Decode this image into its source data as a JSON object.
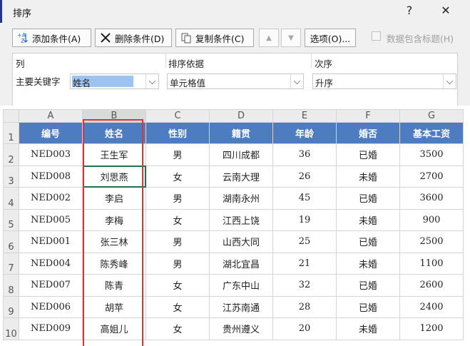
{
  "dialog": {
    "title": "排序",
    "help_label": "?",
    "close_label": "✕",
    "toolbar": {
      "add_label": "添加条件(A)",
      "delete_label": "删除条件(D)",
      "copy_label": "复制条件(C)",
      "up_label": "▲",
      "down_label": "▼",
      "options_label": "选项(O)...",
      "header_checkbox_label": "数据包含标题(H)"
    },
    "columns": {
      "col_header": "列",
      "basis_header": "排序依据",
      "order_header": "次序"
    },
    "criterion": {
      "row_label": "主要关键字",
      "column_value": "姓名",
      "basis_value": "单元格值",
      "order_value": "升序",
      "dropdown_glyph": "⌵"
    }
  },
  "sheet": {
    "col_letters": [
      "A",
      "B",
      "C",
      "D",
      "E",
      "F",
      "G"
    ],
    "headers": [
      "编号",
      "姓名",
      "性别",
      "籍贯",
      "年龄",
      "婚否",
      "基本工资"
    ],
    "rows": [
      [
        "NED003",
        "王生军",
        "男",
        "四川成都",
        "36",
        "已婚",
        "3500"
      ],
      [
        "NED008",
        "刘思燕",
        "女",
        "云南大理",
        "26",
        "未婚",
        "2700"
      ],
      [
        "NED002",
        "李启",
        "男",
        "湖南永州",
        "45",
        "已婚",
        "3600"
      ],
      [
        "NED005",
        "李梅",
        "女",
        "江西上饶",
        "19",
        "未婚",
        "900"
      ],
      [
        "NED001",
        "张三林",
        "男",
        "山西大同",
        "25",
        "已婚",
        "2500"
      ],
      [
        "NED004",
        "陈秀峰",
        "男",
        "湖北宜昌",
        "21",
        "未婚",
        "1100"
      ],
      [
        "NED007",
        "陈青",
        "女",
        "广东中山",
        "32",
        "已婚",
        "2600"
      ],
      [
        "NED006",
        "胡苹",
        "女",
        "江苏南通",
        "28",
        "已婚",
        "2400"
      ],
      [
        "NED009",
        "高姐儿",
        "女",
        "贵州遵义",
        "20",
        "未婚",
        "1200"
      ]
    ],
    "row_numbers": [
      "1",
      "2",
      "3",
      "4",
      "5",
      "6",
      "7",
      "8",
      "9",
      "10"
    ]
  },
  "colors": {
    "header_fill": "#4d7cc0",
    "highlight_box": "#d33333",
    "selection_fill": "#9dc3f0",
    "active_cell_border": "#217346"
  }
}
